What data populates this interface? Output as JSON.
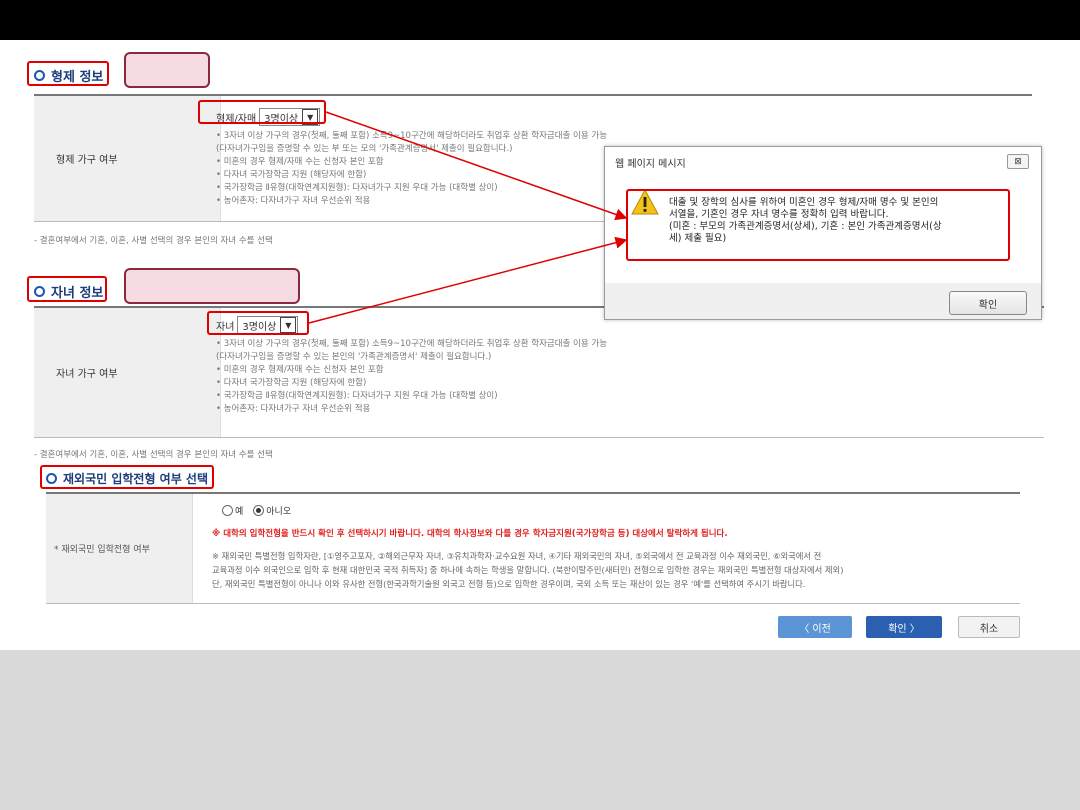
{
  "sibling": {
    "title": "형제 정보",
    "row_label": "형제 가구 여부",
    "select_label": "형제/자매",
    "select_value": "3명이상",
    "notes": [
      "• 3자녀 이상 가구의 경우(첫째, 둘째 포함) 소득9~10구간에 해당하더라도 취업후 상환 학자금대출 이용 가능",
      "  (다자녀가구임을 증명할 수 있는 부 또는 모의 '가족관계증명서' 제출이 필요합니다.)",
      "• 미혼의 경우 형제/자매 수는 신청자 본인 포함",
      "• 다자녀 국가장학금 지원 (해당자에 한함)",
      "• 국가장학금 Ⅱ유형(대학연계지원형): 다자녀가구 지원 우대 가능 (대학별 상이)",
      "• 농어촌자: 다자녀가구 자녀 우선순위 적용"
    ],
    "footnote": "- 결혼여부에서 기혼, 이혼, 사별 선택의 경우 본인의 자녀 수를 선택"
  },
  "children": {
    "title": "자녀 정보",
    "row_label": "자녀 가구 여부",
    "select_label": "자녀",
    "select_value": "3명이상",
    "notes": [
      "• 3자녀 이상 가구의 경우(첫째, 둘째 포함) 소득9~10구간에 해당하더라도 취업후 상환 학자금대출 이용 가능",
      "  (다자녀가구임을 증명할 수 있는 본인의 '가족관계증명서' 제출이 필요합니다.)",
      "• 미혼의 경우 형제/자매 수는 신청자 본인 포함",
      "• 다자녀 국가장학금 지원 (해당자에 한함)",
      "• 국가장학금 Ⅱ유형(대학연계지원형): 다자녀가구 지원 우대 가능 (대학별 상이)",
      "• 농어촌자: 다자녀가구 자녀 우선순위 적용"
    ],
    "footnote": "- 결혼여부에서 기혼, 이혼, 사별 선택의 경우 본인의 자녀 수를 선택"
  },
  "overseas": {
    "title": "재외국민 입학전형 여부 선택",
    "row_label": "* 재외국민 입학전형 여부",
    "option_yes": "예",
    "option_no": "아니오",
    "selected": "아니오",
    "warning": "※ 대학의 입학전형을 반드시 확인 후 선택하시기 바랍니다. 대학의 학사정보와 다를 경우 학자금지원(국가장학금 등) 대상에서 탈락하게 됩니다.",
    "detail": [
      "※ 재외국민 특별전형 입학자란, [①영주고포자, ②해외근무자 자녀, ③유치과학자·교수요원 자녀, ④기타 재외국민의 자녀, ⑤외국에서 전 교육과정 이수 재외국민, ⑥외국에서 전",
      "교육과정 이수 외국인으로 입학 후 현재 대한민국 국적 취득자] 중 하나에 속하는 학생을 말합니다. (북한이탈주민(새터민) 전형으로 입학한 경우는 재외국민 특별전형 대상자에서 제외)",
      "단, 재외국민 특별전형이 아니나 이와 유사한 전형(한국과학기술원 외국고 전형 등)으로 입학한 경우이며, 국외 소득 또는 재산이 있는 경우 '예'를 선택하여 주시기 바랍니다."
    ]
  },
  "dialog": {
    "title": "웹 페이지 메시지",
    "close": "⊠",
    "message": "대출 및 장학의 심사를 위하여 미혼인 경우 형제/자매 명수 및 본인의\n서열을, 기혼인 경우 자녀 명수를 정확히 입력 바랍니다.\n(미혼 : 부모의 가족관계증명서(상세), 기혼 : 본인 가족관계증명서(상\n세) 제출 필요)",
    "ok": "확인"
  },
  "buttons": {
    "prev": "〈  이전",
    "next": "확인  〉",
    "cancel": "취소"
  },
  "colors": {
    "highlight": "#e00000",
    "primary": "#2b5fb0",
    "callout_fill": "#f6dbe3"
  }
}
